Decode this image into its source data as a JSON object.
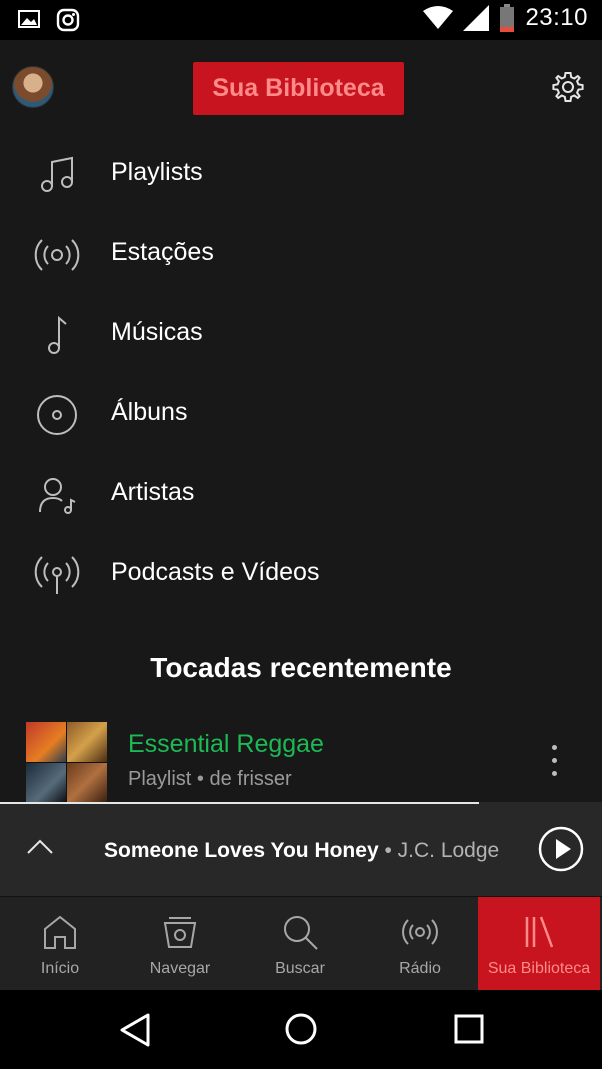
{
  "status_bar": {
    "time": "23:10",
    "icons": [
      "image-icon",
      "instagram-icon",
      "wifi-icon",
      "signal-icon",
      "battery-icon"
    ]
  },
  "header": {
    "title": "Sua Biblioteca",
    "avatar_icon": "avatar",
    "settings_icon": "gear-icon"
  },
  "menu": [
    {
      "label": "Playlists",
      "icon": "music-notes-icon"
    },
    {
      "label": "Estações",
      "icon": "radio-station-icon"
    },
    {
      "label": "Músicas",
      "icon": "music-note-icon"
    },
    {
      "label": "Álbuns",
      "icon": "album-icon"
    },
    {
      "label": "Artistas",
      "icon": "artist-icon"
    },
    {
      "label": "Podcasts e Vídeos",
      "icon": "podcast-icon"
    }
  ],
  "recent": {
    "section_title": "Tocadas recentemente",
    "items": [
      {
        "title": "Essential Reggae",
        "subtitle": "Playlist • de frisser"
      }
    ]
  },
  "now_playing": {
    "song": "Someone Loves You Honey",
    "separator": " • ",
    "artist": "J.C. Lodge",
    "progress": 0.8
  },
  "bottom_nav": [
    {
      "label": "Início",
      "icon": "home-icon",
      "active": false
    },
    {
      "label": "Navegar",
      "icon": "browse-icon",
      "active": false
    },
    {
      "label": "Buscar",
      "icon": "search-icon",
      "active": false
    },
    {
      "label": "Rádio",
      "icon": "radio-icon",
      "active": false
    },
    {
      "label": "Sua Biblioteca",
      "icon": "library-icon",
      "active": true
    }
  ],
  "colors": {
    "accent_green": "#1db954",
    "highlight_red": "#c8141e",
    "background": "#181818"
  }
}
